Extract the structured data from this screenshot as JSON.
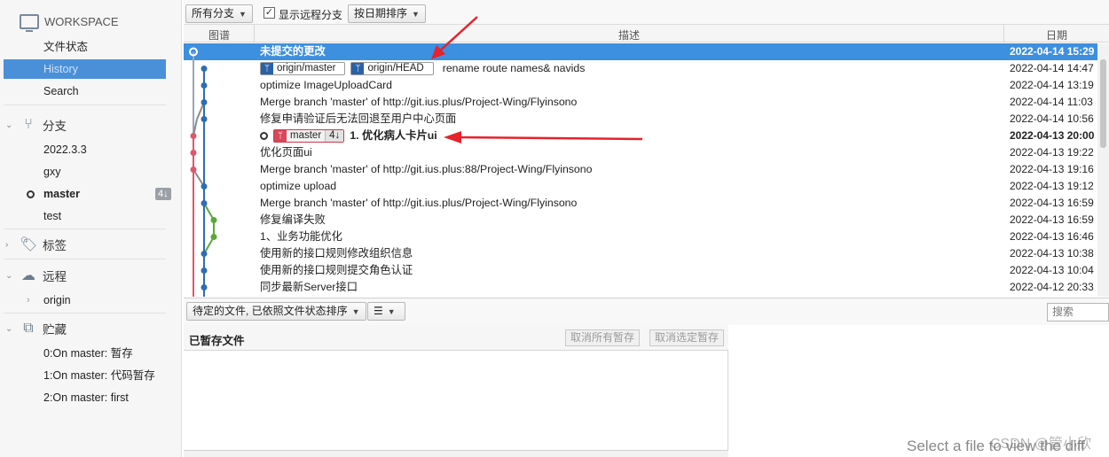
{
  "sidebar": {
    "workspace": "WORKSPACE",
    "items": [
      "文件状态",
      "History",
      "Search"
    ],
    "branches_label": "分支",
    "branches": [
      "2022.3.3",
      "gxy",
      "master",
      "test"
    ],
    "master_badge": "4↓",
    "tags_label": "标签",
    "remote_label": "远程",
    "remotes": [
      "origin"
    ],
    "stash_label": "贮藏",
    "stashes": [
      "0:On master: 暂存",
      "1:On master: 代码暂存",
      "2:On master: first"
    ]
  },
  "toolbar": {
    "branch_filter": "所有分支",
    "show_remote": "显示远程分支",
    "sort": "按日期排序"
  },
  "columns": {
    "graph": "图谱",
    "desc": "描述",
    "date": "日期"
  },
  "commits": [
    {
      "desc": "未提交的更改",
      "date": "2022-04-14 15:29"
    },
    {
      "tags": [
        "origin/master",
        "origin/HEAD"
      ],
      "desc": "rename route names& navids",
      "date": "2022-04-14 14:47"
    },
    {
      "desc": "optimize ImageUploadCard",
      "date": "2022-04-14 13:19"
    },
    {
      "desc": "Merge branch 'master' of http://git.ius.plus/Project-Wing/Flyinsono",
      "date": "2022-04-14 11:03"
    },
    {
      "desc": "修复申请验证后无法回退至用户中心页面",
      "date": "2022-04-14 10:56"
    },
    {
      "tag_master": "master",
      "tag_count": "4↓",
      "desc": "1. 优化病人卡片ui",
      "date": "2022-04-13 20:00"
    },
    {
      "desc": "优化页面ui",
      "date": "2022-04-13 19:22"
    },
    {
      "desc": "Merge branch 'master' of http://git.ius.plus:88/Project-Wing/Flyinsono",
      "date": "2022-04-13 19:16"
    },
    {
      "desc": "optimize upload",
      "date": "2022-04-13 19:12"
    },
    {
      "desc": "Merge branch 'master' of http://git.ius.plus/Project-Wing/Flyinsono",
      "date": "2022-04-13 16:59"
    },
    {
      "desc": "修复编译失败",
      "date": "2022-04-13 16:59"
    },
    {
      "desc": "1、业务功能优化",
      "date": "2022-04-13 16:46"
    },
    {
      "desc": "使用新的接口规则修改组织信息",
      "date": "2022-04-13 10:38"
    },
    {
      "desc": "使用新的接口规则提交角色认证",
      "date": "2022-04-13 10:04"
    },
    {
      "desc": "同步最新Server接口",
      "date": "2022-04-12 20:33"
    }
  ],
  "bottom": {
    "file_filter": "待定的文件, 已依照文件状态排序",
    "search_placeholder": "搜索",
    "staged_title": "已暂存文件",
    "unstage_all": "取消所有暂存",
    "unstage_selected": "取消选定暂存",
    "diff_hint": "Select a file to view the diff",
    "watermark": "CSDN @管小欣"
  },
  "colors": {
    "selection": "#3d8fe0",
    "graph_blue": "#2f6db0",
    "graph_red": "#e0566a",
    "graph_green": "#5aa83a",
    "arrow": "#e8212a"
  }
}
